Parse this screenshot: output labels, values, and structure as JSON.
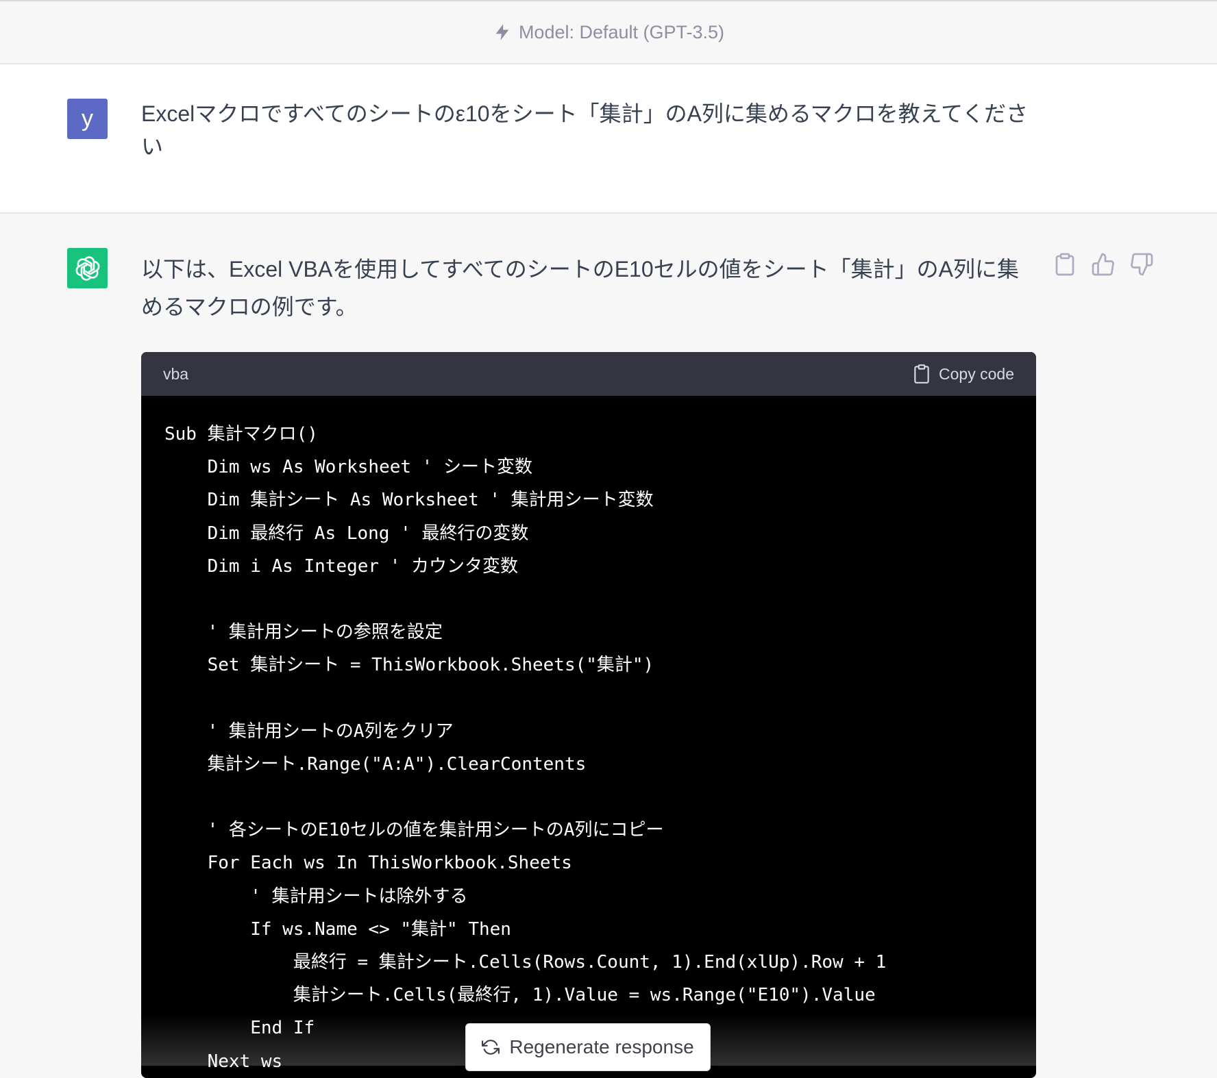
{
  "header": {
    "model_label": "Model: Default (GPT-3.5)"
  },
  "user_message": {
    "avatar_letter": "y",
    "text": "Excelマクロですべてのシートのε10をシート「集計」のA列に集めるマクロを教えてください"
  },
  "assistant_message": {
    "text": "以下は、Excel VBAを使用してすべてのシートのE10セルの値をシート「集計」のA列に集めるマクロの例です。",
    "code_block": {
      "language": "vba",
      "copy_label": "Copy code",
      "lines": [
        "Sub 集計マクロ()",
        "    Dim ws As Worksheet ' シート変数",
        "    Dim 集計シート As Worksheet ' 集計用シート変数",
        "    Dim 最終行 As Long ' 最終行の変数",
        "    Dim i As Integer ' カウンタ変数",
        "",
        "    ' 集計用シートの参照を設定",
        "    Set 集計シート = ThisWorkbook.Sheets(\"集計\")",
        "",
        "    ' 集計用シートのA列をクリア",
        "    集計シート.Range(\"A:A\").ClearContents",
        "",
        "    ' 各シートのE10セルの値を集計用シートのA列にコピー",
        "    For Each ws In ThisWorkbook.Sheets",
        "        ' 集計用シートは除外する",
        "        If ws.Name <> \"集計\" Then",
        "            最終行 = 集計シート.Cells(Rows.Count, 1).End(xlUp).Row + 1",
        "            集計シート.Cells(最終行, 1).Value = ws.Range(\"E10\").Value",
        "        End If",
        "    Next ws"
      ]
    }
  },
  "regenerate": {
    "label": "Regenerate response"
  },
  "colors": {
    "user_avatar": "#5d6ac5",
    "assistant_avatar": "#19c37d",
    "code_background": "#000000",
    "code_header": "#343541"
  }
}
